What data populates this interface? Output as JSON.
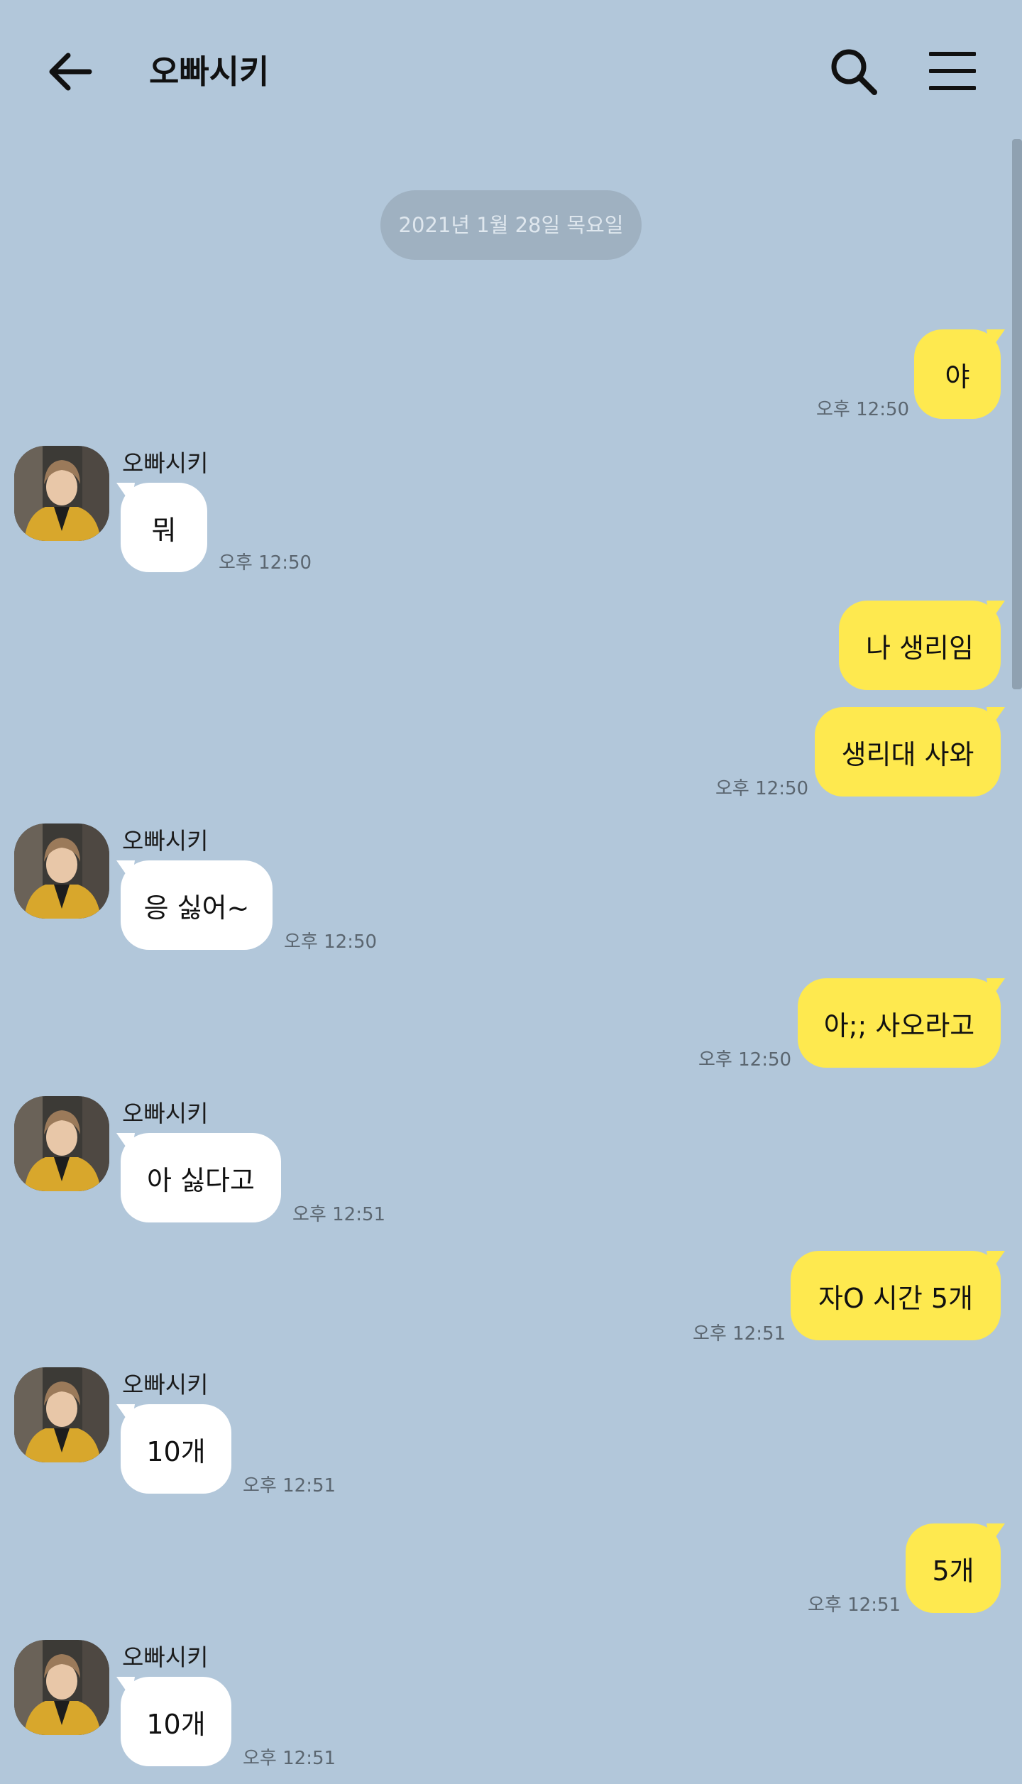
{
  "header": {
    "title": "오빠시키",
    "back_icon": "arrow-left-icon",
    "search_icon": "search-icon",
    "menu_icon": "menu-icon"
  },
  "date_divider": "2021년 1월 28일 목요일",
  "colors": {
    "background": "#b2c7da",
    "my_bubble": "#fee94f",
    "their_bubble": "#ffffff",
    "date_pill": "#9fb1c1"
  },
  "messages": [
    {
      "from": "me",
      "text": "야",
      "time": "오후 12:50"
    },
    {
      "from": "them",
      "sender": "오빠시키",
      "text": "뭐",
      "time": "오후 12:50"
    },
    {
      "from": "me",
      "text": "나 생리임"
    },
    {
      "from": "me",
      "text": "생리대 사와",
      "time": "오후 12:50"
    },
    {
      "from": "them",
      "sender": "오빠시키",
      "text": "응 싫어~",
      "time": "오후 12:50"
    },
    {
      "from": "me",
      "text": "아;; 사오라고",
      "time": "오후 12:50"
    },
    {
      "from": "them",
      "sender": "오빠시키",
      "text": "아 싫다고",
      "time": "오후 12:51"
    },
    {
      "from": "me",
      "text": "자O 시간 5개",
      "time": "오후 12:51"
    },
    {
      "from": "them",
      "sender": "오빠시키",
      "text": "10개",
      "time": "오후 12:51"
    },
    {
      "from": "me",
      "text": "5개",
      "time": "오후 12:51"
    },
    {
      "from": "them",
      "sender": "오빠시키",
      "text": "10개",
      "time": "오후 12:51"
    }
  ]
}
